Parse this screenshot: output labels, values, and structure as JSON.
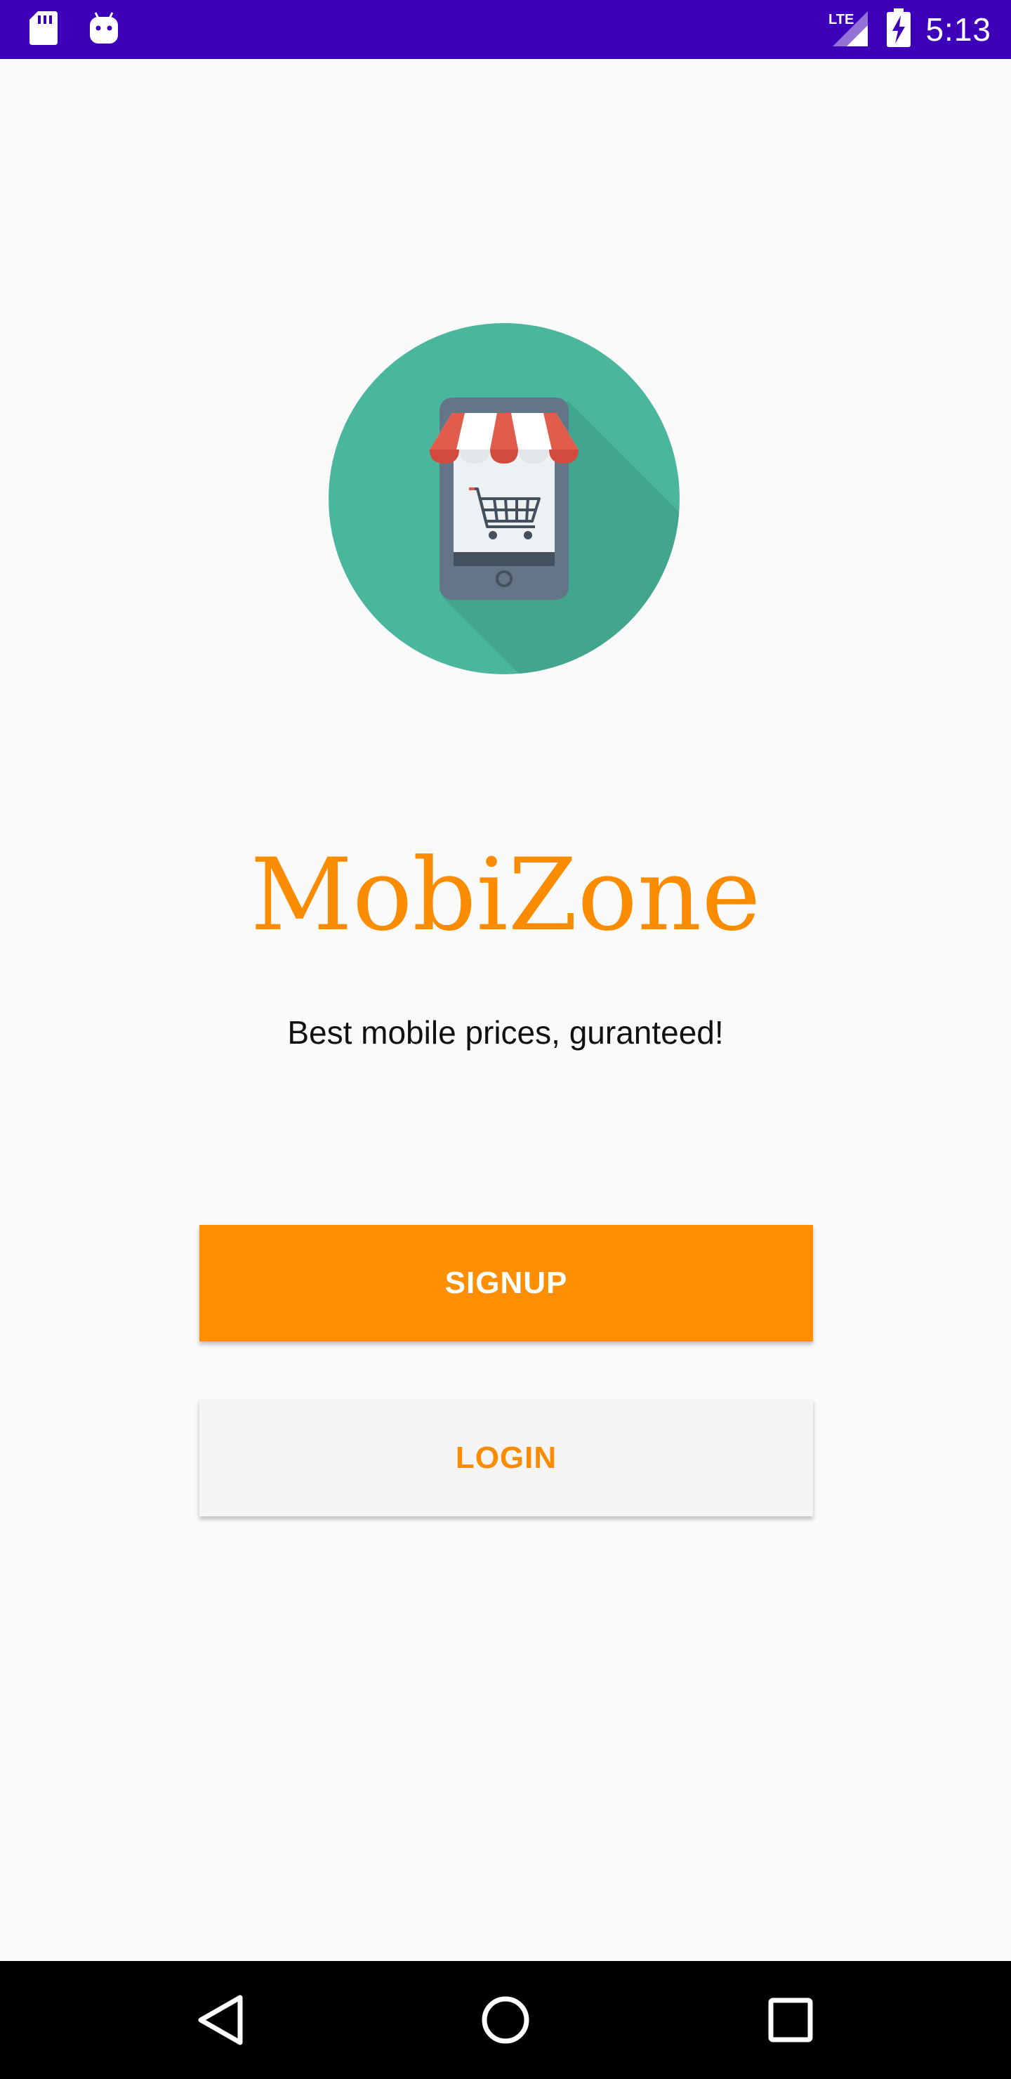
{
  "status_bar": {
    "time": "5:13",
    "network_label": "LTE",
    "icons": [
      "sd-card-icon",
      "android-icon",
      "lte-signal-icon",
      "battery-charging-icon"
    ],
    "background_color": "#3d00b8"
  },
  "app": {
    "title": "MobiZone",
    "tagline": "Best mobile prices, guranteed!",
    "logo_icon": "shopping-cart-store-icon",
    "accent_color": "#ff8f00"
  },
  "actions": {
    "signup_label": "SIGNUP",
    "login_label": "LOGIN"
  },
  "nav_bar": {
    "icons": [
      "back-icon",
      "home-icon",
      "recents-icon"
    ]
  }
}
